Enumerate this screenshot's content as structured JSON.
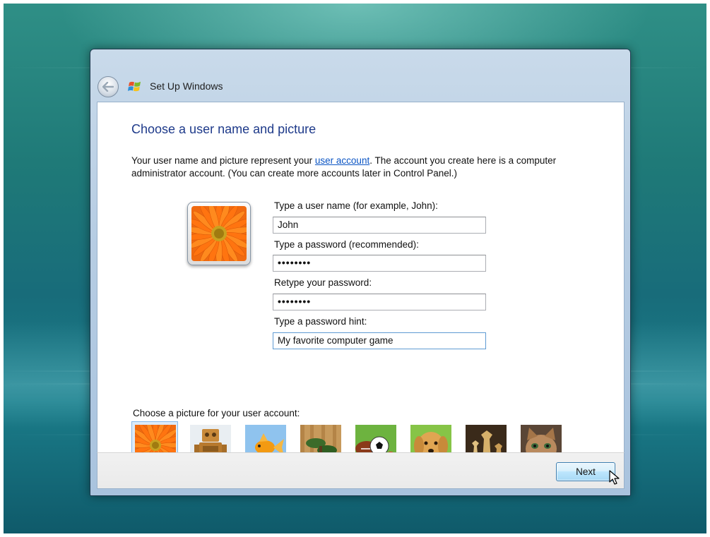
{
  "window": {
    "title": "Set Up Windows"
  },
  "page": {
    "heading": "Choose a user name and picture",
    "description_before": "Your user name and picture represent your ",
    "description_link": "user account",
    "description_after": ". The account you create here is a computer administrator account. (You can create more accounts later in Control Panel.)"
  },
  "form": {
    "username_label": "Type a user name (for example, John):",
    "username_value": "John",
    "password_label": "Type a password (recommended):",
    "password_value": "••••••••",
    "retype_label": "Retype your password:",
    "retype_value": "••••••••",
    "hint_label": "Type a password hint:",
    "hint_value": "My favorite computer game"
  },
  "pictures": {
    "label": "Choose a picture for your user account:",
    "items": [
      "flower",
      "robot",
      "goldfish",
      "bonsai",
      "sports-balls",
      "dog",
      "chess",
      "kitten"
    ],
    "selected": "flower"
  },
  "buttons": {
    "next": "Next"
  },
  "icons": {
    "back": "back-arrow-icon",
    "windows_flag": "windows-flag-icon",
    "cursor": "pointer-cursor-icon"
  },
  "colors": {
    "heading": "#1e3a8a",
    "link": "#0b55c4",
    "selection": "#86b8e8"
  }
}
